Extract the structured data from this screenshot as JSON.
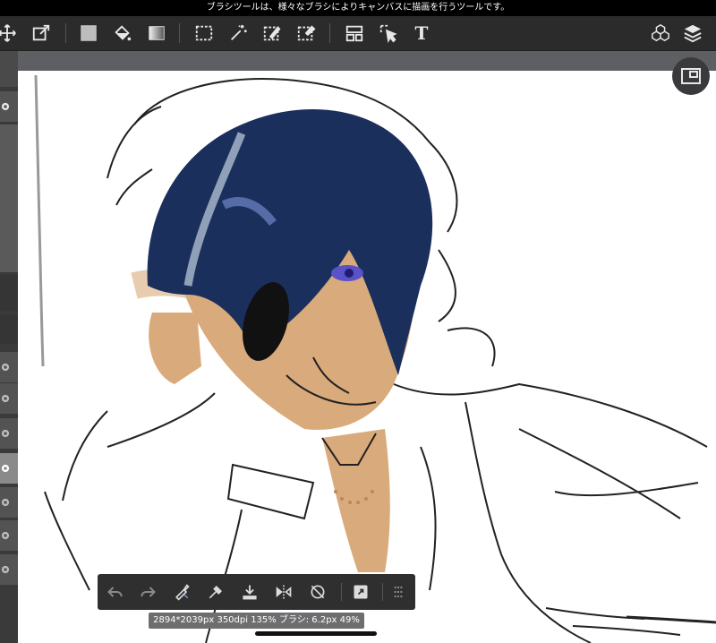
{
  "status_bar": {
    "tooltip": "ブラシツールは、様々なブラシによりキャンバスに描画を行うツールです。"
  },
  "toolbar": {
    "items": [
      {
        "icon": "move-icon"
      },
      {
        "icon": "transform-icon"
      },
      {
        "icon": "fill-color-swatch"
      },
      {
        "icon": "bucket-icon"
      },
      {
        "icon": "gradient-icon"
      },
      {
        "icon": "rect-select-icon"
      },
      {
        "icon": "magic-wand-icon"
      },
      {
        "icon": "select-pen-icon"
      },
      {
        "icon": "select-eraser-icon"
      },
      {
        "icon": "panel-icon"
      },
      {
        "icon": "pointer-select-icon"
      },
      {
        "icon": "text-icon"
      },
      {
        "icon": "3d-icon"
      },
      {
        "icon": "layers-icon"
      }
    ],
    "text_tool_label": "T"
  },
  "bottom_toolbar": {
    "items": [
      {
        "icon": "undo-icon"
      },
      {
        "icon": "redo-icon"
      },
      {
        "icon": "brush-eraser-icon"
      },
      {
        "icon": "eyedropper-icon"
      },
      {
        "icon": "save-download-icon"
      },
      {
        "icon": "flip-icon"
      },
      {
        "icon": "rotate-reset-icon"
      },
      {
        "icon": "export-icon"
      },
      {
        "icon": "grid-dots-icon"
      }
    ]
  },
  "info": {
    "text": "2894*2039px 350dpi 135% ブラシ: 6.2px 49%"
  },
  "colors": {
    "hair": "#1b2f5c",
    "skin": "#d9aa7b",
    "toolbar_bg": "#2b2b2b"
  }
}
